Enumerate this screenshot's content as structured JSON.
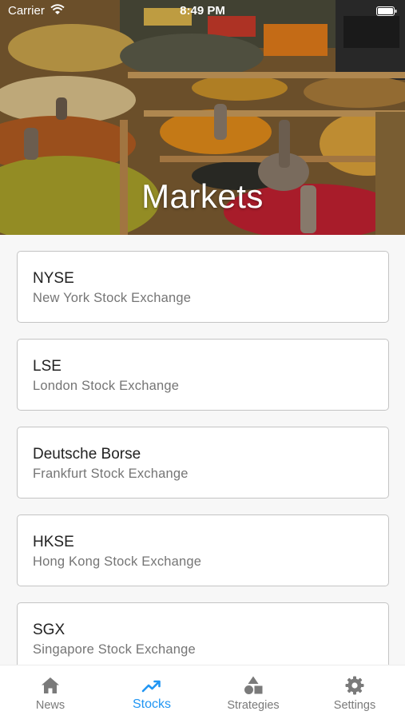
{
  "status_bar": {
    "carrier": "Carrier",
    "time": "8:49 PM"
  },
  "header": {
    "title": "Markets",
    "background_image": "spice-market-photo"
  },
  "markets": [
    {
      "code": "NYSE",
      "name": "New York Stock Exchange"
    },
    {
      "code": "LSE",
      "name": "London Stock Exchange"
    },
    {
      "code": "Deutsche Borse",
      "name": "Frankfurt Stock Exchange"
    },
    {
      "code": "HKSE",
      "name": "Hong Kong Stock Exchange"
    },
    {
      "code": "SGX",
      "name": "Singapore Stock Exchange"
    }
  ],
  "tab_bar": {
    "active": "Stocks",
    "tabs": [
      {
        "label": "News",
        "icon": "home-icon"
      },
      {
        "label": "Stocks",
        "icon": "trending-up-icon"
      },
      {
        "label": "Strategies",
        "icon": "shapes-icon"
      },
      {
        "label": "Settings",
        "icon": "gear-icon"
      }
    ]
  },
  "colors": {
    "accent": "#2196f3",
    "inactive_tab": "#7a7a7a",
    "card_border": "#c4c4c4",
    "subtitle_text": "#757575"
  }
}
